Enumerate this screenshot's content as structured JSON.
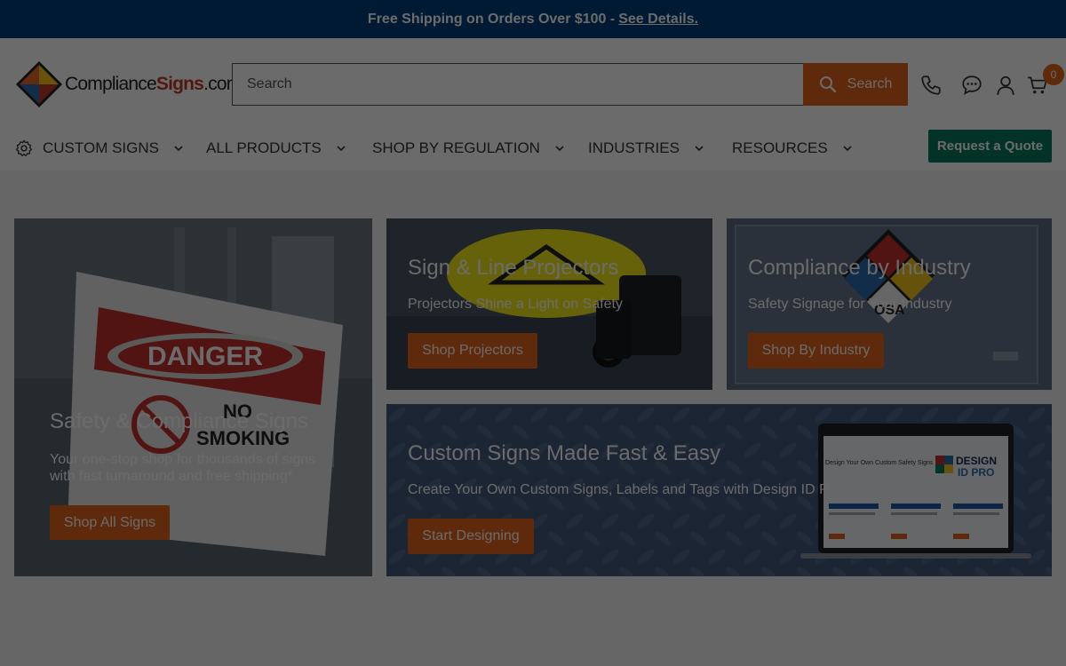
{
  "topbar": {
    "text": "Free Shipping on Orders Over $100 -",
    "link": "See Details."
  },
  "logo": {
    "compliance": "Compliance",
    "signs": "Signs",
    "dotcom": ".com"
  },
  "search": {
    "placeholder": "Search",
    "button_label": "Search"
  },
  "cart": {
    "count": "0"
  },
  "nav": {
    "items": [
      {
        "label": "CUSTOM SIGNS"
      },
      {
        "label": "ALL PRODUCTS"
      },
      {
        "label": "SHOP BY REGULATION"
      },
      {
        "label": "INDUSTRIES"
      },
      {
        "label": "RESOURCES"
      }
    ],
    "quote_button": "Request a Quote"
  },
  "cards": {
    "safety": {
      "title": "Safety & Compliance Signs",
      "subtitle_1": "Your one-stop shop for thousands of signs",
      "subtitle_2": "with fast turnaround and free shipping*",
      "button": "Shop All Signs",
      "sign_text_1": "DANGER",
      "sign_text_2": "NO",
      "sign_text_3": "SMOKING"
    },
    "projectors": {
      "title": "Sign & Line Projectors",
      "subtitle": "Projectors Shine a Light on Safety",
      "button": "Shop Projectors"
    },
    "industry": {
      "title": "Compliance by Industry",
      "subtitle": "Safety Signage for Your Industry",
      "button": "Shop By Industry",
      "diamond_text": "OSA"
    },
    "custom": {
      "title": "Custom Signs Made Fast & Easy",
      "subtitle": "Create Your Own Custom Signs, Labels and Tags with Design ID P",
      "button": "Start Designing",
      "screen_heading": "Design Your Own Custom Safety Signs",
      "logo_line_1": "DESIGN",
      "logo_line_2": "ID PRO"
    }
  },
  "colors": {
    "topbar": "#003e7a",
    "accent": "#e2621b",
    "quote": "#087a5c"
  }
}
